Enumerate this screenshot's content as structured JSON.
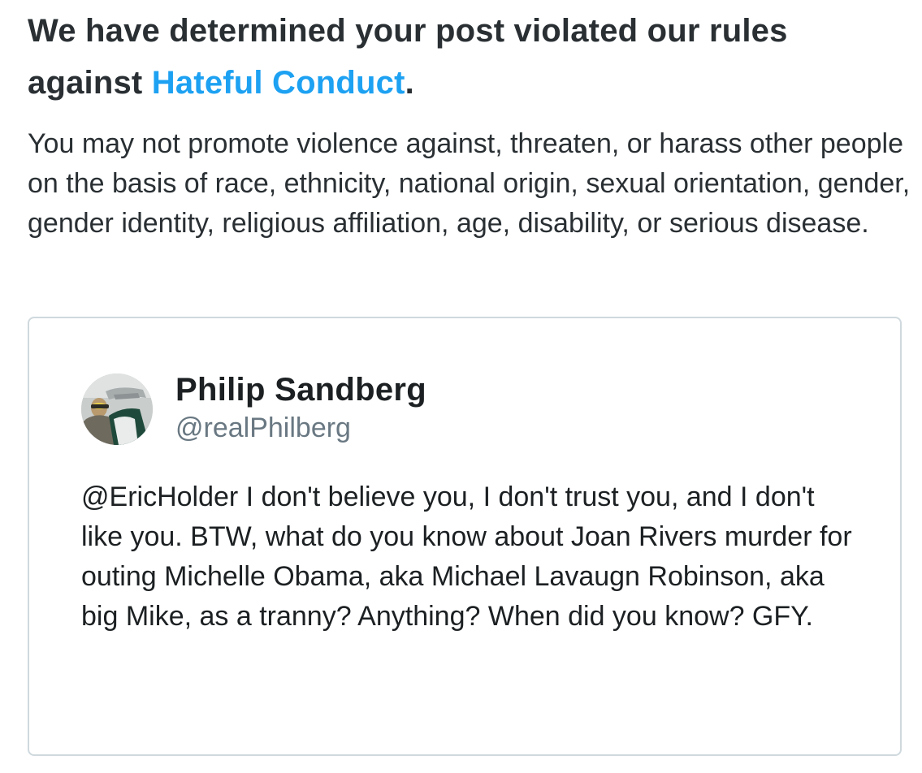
{
  "notice": {
    "heading_prefix": "We have determined your post violated our rules against ",
    "rule_link": "Hateful Conduct",
    "heading_suffix": ".",
    "body": "You may not promote violence against, threaten, or harass other people on the basis of race, ethnicity, national origin, sexual orientation, gender, gender identity, religious affiliation, age, disability, or serious disease."
  },
  "tweet": {
    "author_name": "Philip Sandberg",
    "author_handle": "@realPhilberg",
    "text": "@EricHolder I don't believe you, I don't trust you, and I don't like you. BTW, what do you know about Joan Rivers murder for outing Michelle Obama, aka Michael Lavaugn Robinson, aka big Mike, as a tranny? Anything? When did you know? GFY."
  },
  "colors": {
    "link": "#1da1f2",
    "heading": "#292f33",
    "handle": "#697882",
    "card_border": "#cfd9de"
  }
}
